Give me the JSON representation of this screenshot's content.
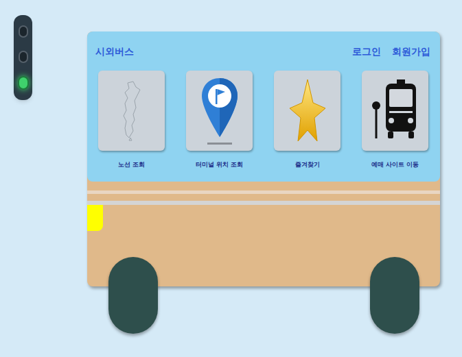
{
  "traffic_light": {
    "lights": [
      {
        "on": false
      },
      {
        "on": false
      },
      {
        "on": true
      }
    ]
  },
  "header": {
    "title": "시외버스",
    "links": [
      "로그인",
      "회원가입"
    ]
  },
  "menu": [
    {
      "label": "노선 조회",
      "icon": "map"
    },
    {
      "label": "터미널 위치 조회",
      "icon": "pin"
    },
    {
      "label": "즐겨찾기",
      "icon": "star"
    },
    {
      "label": "예매 사이트 이동",
      "icon": "bus"
    }
  ]
}
